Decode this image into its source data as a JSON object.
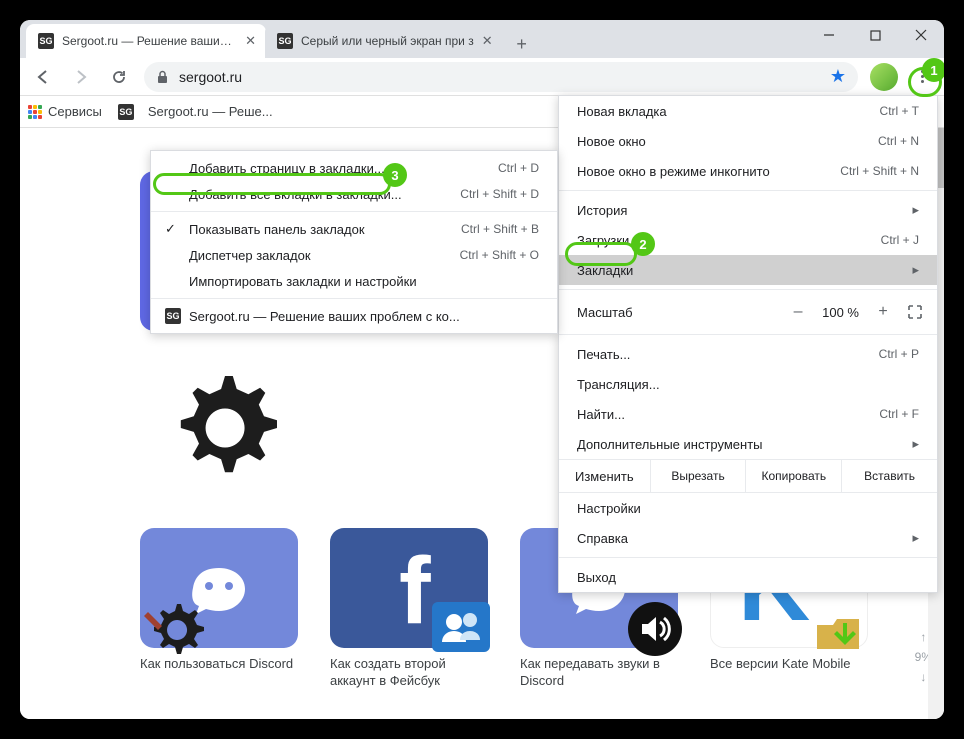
{
  "tabs": [
    {
      "title": "Sergoot.ru — Решение ваших пр",
      "favicon": "SG"
    },
    {
      "title": "Серый или черный экран при з",
      "favicon": "SG"
    }
  ],
  "omnibox": {
    "url": "sergoot.ru"
  },
  "bookmarks_bar": {
    "services": "Сервисы",
    "item1": "Sergoot.ru — Реше..."
  },
  "tiles": [
    {
      "label": "Как пользоваться Discord"
    },
    {
      "label": "Как создать второй аккаунт в Фейсбук"
    },
    {
      "label": "Как передавать звуки в Discord"
    },
    {
      "label": "Все версии Kate Mobile"
    }
  ],
  "main_menu": {
    "new_tab": "Новая вкладка",
    "new_tab_sc": "Ctrl + T",
    "new_window": "Новое окно",
    "new_window_sc": "Ctrl + N",
    "incognito": "Новое окно в режиме инкогнито",
    "incognito_sc": "Ctrl + Shift + N",
    "history": "История",
    "downloads": "Загрузки",
    "downloads_sc": "Ctrl + J",
    "bookmarks": "Закладки",
    "zoom_label": "Масштаб",
    "zoom_value": "100 %",
    "print": "Печать...",
    "print_sc": "Ctrl + P",
    "cast": "Трансляция...",
    "find": "Найти...",
    "find_sc": "Ctrl + F",
    "more_tools": "Дополнительные инструменты",
    "edit": "Изменить",
    "cut": "Вырезать",
    "copy": "Копировать",
    "paste": "Вставить",
    "settings": "Настройки",
    "help": "Справка",
    "exit": "Выход"
  },
  "sub_menu": {
    "add_page": "Добавить страницу в закладки...",
    "add_page_sc": "Ctrl + D",
    "add_all": "Добавить все вкладки в закладки...",
    "add_all_sc": "Ctrl + Shift + D",
    "show_bar": "Показывать панель закладок",
    "show_bar_sc": "Ctrl + Shift + B",
    "manager": "Диспетчер закладок",
    "manager_sc": "Ctrl + Shift + O",
    "import": "Импортировать закладки и настройки",
    "bk1": "Sergoot.ru — Решение ваших проблем с ко..."
  },
  "scroll_percent": "9%"
}
